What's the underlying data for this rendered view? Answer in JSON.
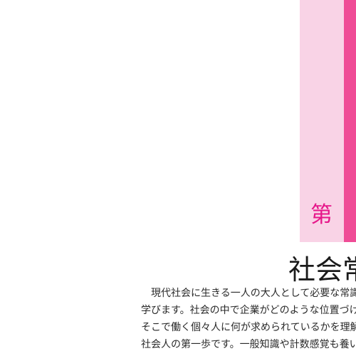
{
  "colors": {
    "background": "#ffffff",
    "band_light": "#f9d3e6",
    "band_dark": "#ef4c96",
    "chapter_mark": "#e6178a",
    "text": "#2a2a2a"
  },
  "chapter": {
    "mark": "第"
  },
  "section": {
    "title": "社会常"
  },
  "intro": {
    "lines": [
      "　現代社会に生きる一人の大人として必要な常識や",
      "学びます。社会の中で企業がどのような位置づけに",
      "そこで働く個々人に何が求められているかを理解す",
      "社会人の第一歩です。一般知識や計数感覚も養いま"
    ]
  }
}
